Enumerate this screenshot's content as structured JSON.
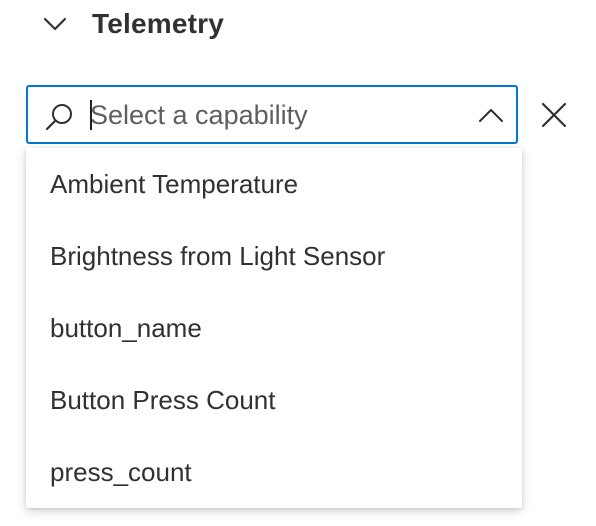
{
  "section": {
    "title": "Telemetry",
    "expand_icon": "chevron-down-icon"
  },
  "combobox": {
    "placeholder": "Select a capability",
    "value": "",
    "search_icon": "search-icon",
    "toggle_icon": "chevron-up-icon",
    "clear_icon": "close-icon",
    "border_color": "#0078d4"
  },
  "dropdown": {
    "options": [
      {
        "label": "Ambient Temperature"
      },
      {
        "label": "Brightness from Light Sensor"
      },
      {
        "label": "button_name"
      },
      {
        "label": "Button Press Count"
      },
      {
        "label": "press_count"
      }
    ]
  }
}
